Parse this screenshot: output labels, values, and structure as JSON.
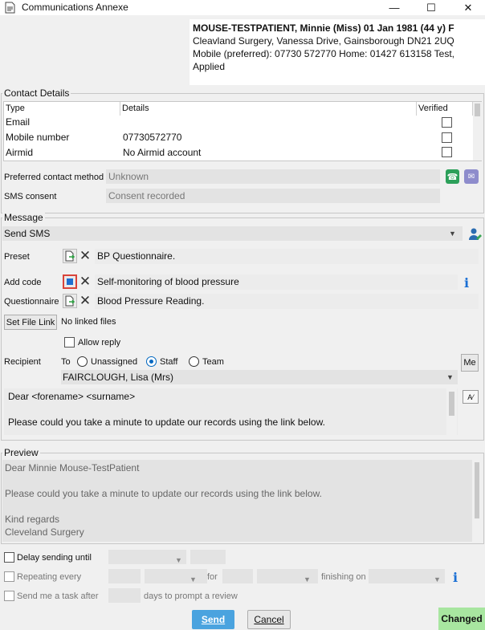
{
  "window": {
    "title": "Communications Annexe",
    "minimize": "—",
    "maximize": "☐",
    "close": "✕"
  },
  "patient": {
    "line1": "MOUSE-TESTPATIENT, Minnie (Miss) 01 Jan 1981 (44 y) F",
    "line2": "Cleavland Surgery, Vanessa Drive, Gainsborough DN21 2UQ",
    "line3": "Mobile (preferred): 07730 572770 Home: 01427 613158   Test,",
    "line4": "Applied"
  },
  "contact": {
    "group_label": "Contact Details",
    "columns": [
      "Type",
      "Details",
      "Verified"
    ],
    "rows": [
      {
        "type": "Email",
        "details": ""
      },
      {
        "type": "Mobile number",
        "details": "07730572770"
      },
      {
        "type": "Airmid",
        "details": "No Airmid account"
      }
    ],
    "preferred_label": "Preferred contact method",
    "preferred_value": "Unknown",
    "sms_label": "SMS consent",
    "sms_value": "Consent recorded"
  },
  "message": {
    "group_label": "Message",
    "type_value": "Send SMS",
    "preset_label": "Preset",
    "preset_value": "BP Questionnaire.",
    "addcode_label": "Add code",
    "addcode_value": "Self-monitoring of blood pressure",
    "questionnaire_label": "Questionnaire",
    "questionnaire_value": "Blood Pressure Reading.",
    "file_link_button": "Set File Link",
    "file_link_value": "No linked files",
    "allow_reply": "Allow reply",
    "recipient_label": "Recipient",
    "to_label": "To",
    "radio_unassigned": "Unassigned",
    "radio_staff": "Staff",
    "radio_team": "Team",
    "me_button": "Me",
    "recipient_value": "FAIRCLOUGH, Lisa (Mrs)",
    "body_line1": "Dear <forename> <surname>",
    "body_line2": "Please could you take a minute to update our records using the link below."
  },
  "preview": {
    "group_label": "Preview",
    "line1": "Dear Minnie Mouse-TestPatient",
    "line2": "Please could you take a minute to update our records using the link below.",
    "line3": "Kind regards",
    "line4": "Cleveland Surgery"
  },
  "options": {
    "delay_label": "Delay sending until",
    "repeat_label": "Repeating every",
    "for_label": "for",
    "finishing_label": "finishing on",
    "task_label": "Send me a task after",
    "task_suffix": "days to prompt a review"
  },
  "footer": {
    "send": "Send",
    "cancel": "Cancel",
    "status": "Changed"
  },
  "colors": {
    "accent": "#4aa3df",
    "changed": "#a8e6a0",
    "info": "#1a6fd4"
  }
}
